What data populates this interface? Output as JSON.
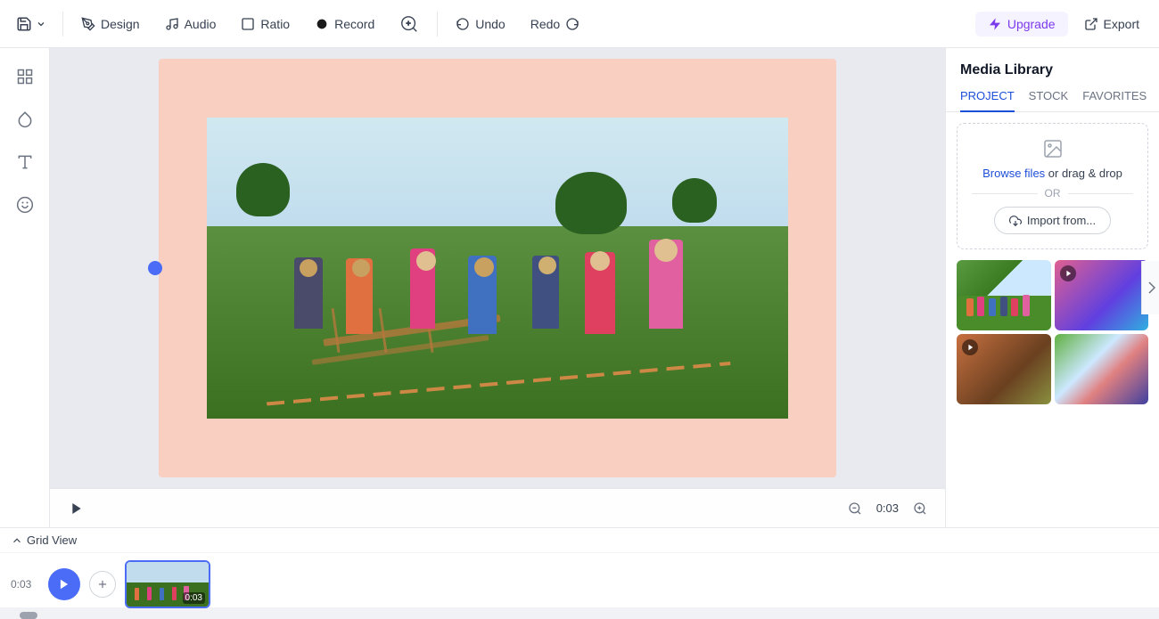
{
  "toolbar": {
    "save_label": "Save",
    "design_label": "Design",
    "audio_label": "Audio",
    "ratio_label": "Ratio",
    "record_label": "Record",
    "search_label": "",
    "undo_label": "Undo",
    "redo_label": "Redo",
    "upgrade_label": "Upgrade",
    "export_label": "Export"
  },
  "sidebar": {
    "tools": [
      "layout",
      "droplet",
      "text",
      "smiley"
    ]
  },
  "canvas": {
    "time_display": "0:03",
    "background_color": "#f8cfc0"
  },
  "media_library": {
    "title": "Media Library",
    "tabs": [
      {
        "label": "PROJECT",
        "active": true
      },
      {
        "label": "STOCK",
        "active": false
      },
      {
        "label": "FAVORITES",
        "active": false
      }
    ],
    "upload": {
      "browse_text": "Browse files",
      "drag_text": " or drag & drop",
      "or_text": "OR",
      "import_label": "Import from..."
    },
    "thumbs": [
      {
        "type": "image",
        "bg_class": "thumb-1"
      },
      {
        "type": "video",
        "bg_class": "thumb-2"
      },
      {
        "type": "video",
        "bg_class": "thumb-3"
      },
      {
        "type": "image",
        "bg_class": "thumb-4"
      }
    ]
  },
  "timeline": {
    "grid_view_label": "Grid View",
    "timestamp": "0:03",
    "clip_duration": "0:03"
  }
}
